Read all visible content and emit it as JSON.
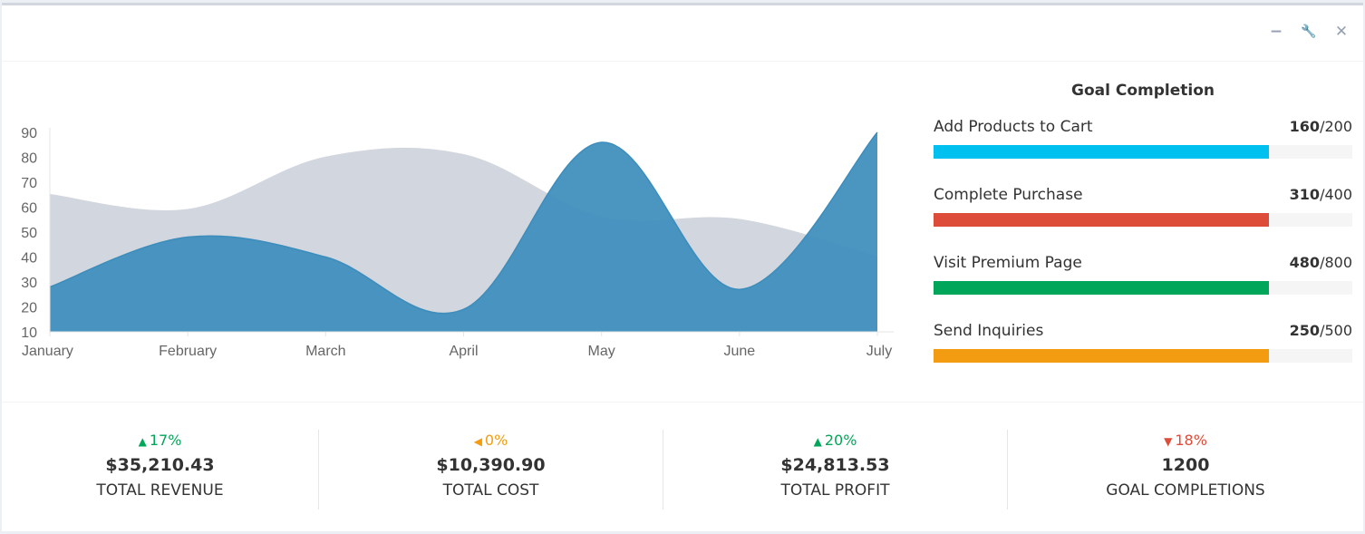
{
  "header": {
    "tools": [
      {
        "name": "collapse",
        "icon": "minus-icon",
        "glyph": "−"
      },
      {
        "name": "settings",
        "icon": "wrench-icon",
        "glyph": "🔧"
      },
      {
        "name": "remove",
        "icon": "close-icon",
        "glyph": "✕"
      }
    ]
  },
  "chart_data": {
    "type": "area",
    "categories": [
      "January",
      "February",
      "March",
      "April",
      "May",
      "June",
      "July"
    ],
    "yticks": [
      10,
      20,
      30,
      40,
      50,
      60,
      70,
      80,
      90
    ],
    "ylim": [
      10,
      90
    ],
    "series": [
      {
        "values": [
          65,
          59,
          80,
          81,
          56,
          55,
          40
        ],
        "color": "#d2d6de"
      },
      {
        "values": [
          28,
          48,
          40,
          19,
          86,
          27,
          90
        ],
        "color": "#3c8dbc"
      }
    ],
    "grid": false
  },
  "goals": {
    "title": "Goal Completion",
    "items": [
      {
        "label": "Add Products to Cart",
        "value": "160",
        "total": "/200",
        "fraction": 0.8,
        "color": "#00c0ef"
      },
      {
        "label": "Complete Purchase",
        "value": "310",
        "total": "/400",
        "fraction": 0.8,
        "color": "#dd4b39"
      },
      {
        "label": "Visit Premium Page",
        "value": "480",
        "total": "/800",
        "fraction": 0.8,
        "color": "#00a65a"
      },
      {
        "label": "Send Inquiries",
        "value": "250",
        "total": "/500",
        "fraction": 0.8,
        "color": "#f39c12"
      }
    ]
  },
  "stats": [
    {
      "pct": "17%",
      "arrow": "▲",
      "color": "#00a65a",
      "amount": "$35,210.43",
      "label": "TOTAL REVENUE"
    },
    {
      "pct": "0%",
      "arrow": "◀",
      "color": "#f39c12",
      "amount": "$10,390.90",
      "label": "TOTAL COST"
    },
    {
      "pct": "20%",
      "arrow": "▲",
      "color": "#00a65a",
      "amount": "$24,813.53",
      "label": "TOTAL PROFIT"
    },
    {
      "pct": "18%",
      "arrow": "▼",
      "color": "#dd4b39",
      "amount": "1200",
      "label": "GOAL COMPLETIONS"
    }
  ]
}
